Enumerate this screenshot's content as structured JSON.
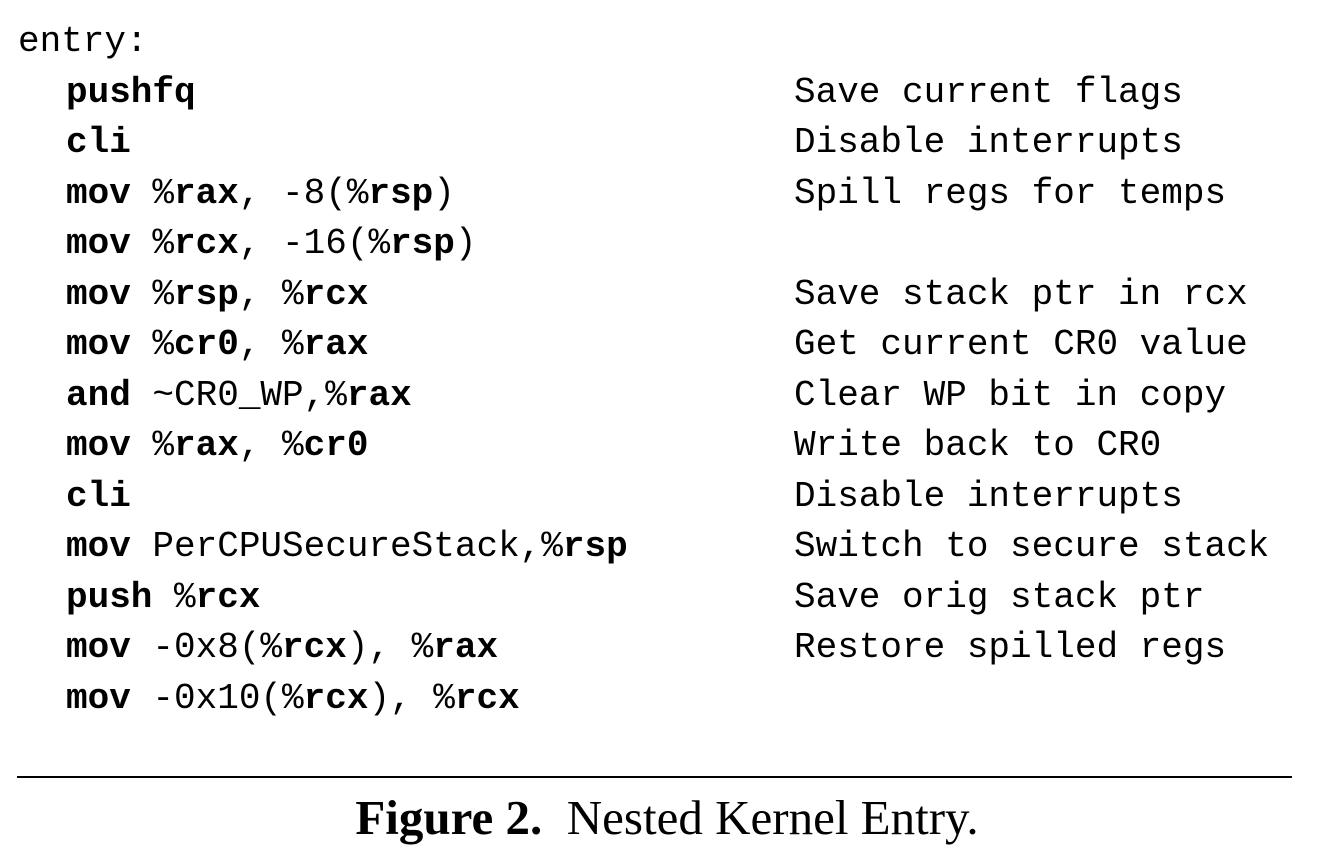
{
  "listing": {
    "label": "entry:",
    "lines": [
      {
        "parts": [
          {
            "t": "pushfq",
            "s": "op"
          }
        ],
        "comment": "Save current flags"
      },
      {
        "parts": [
          {
            "t": "cli",
            "s": "op"
          }
        ],
        "comment": "Disable interrupts"
      },
      {
        "parts": [
          {
            "t": "mov",
            "s": "op"
          },
          {
            "t": " %",
            "s": "plain"
          },
          {
            "t": "rax",
            "s": "reg"
          },
          {
            "t": ", -8(%",
            "s": "plain"
          },
          {
            "t": "rsp",
            "s": "reg"
          },
          {
            "t": ")",
            "s": "plain"
          }
        ],
        "comment": "Spill regs for temps"
      },
      {
        "parts": [
          {
            "t": "mov",
            "s": "op"
          },
          {
            "t": " %",
            "s": "plain"
          },
          {
            "t": "rcx",
            "s": "reg"
          },
          {
            "t": ", -16(%",
            "s": "plain"
          },
          {
            "t": "rsp",
            "s": "reg"
          },
          {
            "t": ")",
            "s": "plain"
          }
        ],
        "comment": ""
      },
      {
        "parts": [
          {
            "t": "mov",
            "s": "op"
          },
          {
            "t": " %",
            "s": "plain"
          },
          {
            "t": "rsp",
            "s": "reg"
          },
          {
            "t": ", %",
            "s": "plain"
          },
          {
            "t": "rcx",
            "s": "reg"
          }
        ],
        "comment": "Save stack ptr in rcx"
      },
      {
        "parts": [
          {
            "t": "mov",
            "s": "op"
          },
          {
            "t": " %",
            "s": "plain"
          },
          {
            "t": "cr0",
            "s": "reg"
          },
          {
            "t": ", %",
            "s": "plain"
          },
          {
            "t": "rax",
            "s": "reg"
          }
        ],
        "comment": "Get current CR0 value"
      },
      {
        "parts": [
          {
            "t": "and",
            "s": "op"
          },
          {
            "t": " ~CR0_WP,%",
            "s": "plain"
          },
          {
            "t": "rax",
            "s": "reg"
          }
        ],
        "comment": "Clear WP bit in copy"
      },
      {
        "parts": [
          {
            "t": "mov",
            "s": "op"
          },
          {
            "t": " %",
            "s": "plain"
          },
          {
            "t": "rax",
            "s": "reg"
          },
          {
            "t": ", %",
            "s": "plain"
          },
          {
            "t": "cr0",
            "s": "reg"
          }
        ],
        "comment": "Write back to CR0"
      },
      {
        "parts": [
          {
            "t": "cli",
            "s": "op"
          }
        ],
        "comment": "Disable interrupts"
      },
      {
        "parts": [
          {
            "t": "mov",
            "s": "op"
          },
          {
            "t": " PerCPUSecureStack,%",
            "s": "plain"
          },
          {
            "t": "rsp",
            "s": "reg"
          }
        ],
        "comment": "Switch to secure stack"
      },
      {
        "parts": [
          {
            "t": "push",
            "s": "op"
          },
          {
            "t": " %",
            "s": "plain"
          },
          {
            "t": "rcx",
            "s": "reg"
          }
        ],
        "comment": "Save orig stack ptr"
      },
      {
        "parts": [
          {
            "t": "mov",
            "s": "op"
          },
          {
            "t": " -0x8(%",
            "s": "plain"
          },
          {
            "t": "rcx",
            "s": "reg"
          },
          {
            "t": "), %",
            "s": "plain"
          },
          {
            "t": "rax",
            "s": "reg"
          }
        ],
        "comment": "Restore spilled regs"
      },
      {
        "parts": [
          {
            "t": "mov",
            "s": "op"
          },
          {
            "t": " -0x10(%",
            "s": "plain"
          },
          {
            "t": "rcx",
            "s": "reg"
          },
          {
            "t": "), %",
            "s": "plain"
          },
          {
            "t": "rcx",
            "s": "reg"
          }
        ],
        "comment": ""
      }
    ]
  },
  "caption": {
    "label": "Figure 2.",
    "text": "Nested Kernel Entry."
  }
}
